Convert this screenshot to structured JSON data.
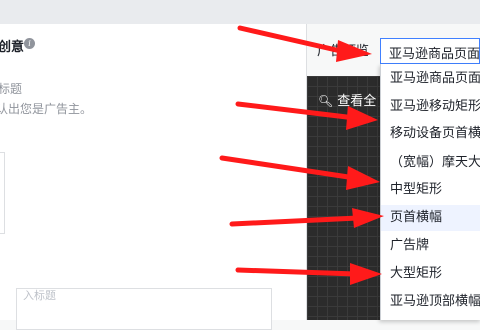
{
  "left_panel": {
    "title": "创意",
    "info_icon": "info-icon",
    "hint_line1": "标题",
    "hint_line2": "认出您是广告主。",
    "bottom_placeholder": "入标题"
  },
  "preview": {
    "label": "广告预览",
    "selected": "亚马逊商品页面",
    "view_all": "查看全",
    "search_icon": "search-icon"
  },
  "dropdown": {
    "items": [
      "亚马逊商品页面",
      "亚马逊移动矩形",
      "移动设备页首横幅",
      "（宽幅）摩天大楼",
      "中型矩形",
      "页首横幅",
      "广告牌",
      "大型矩形",
      "亚马逊顶部横幅"
    ]
  },
  "annotations": {
    "arrow_color": "#ff1a1a",
    "count": 5
  }
}
